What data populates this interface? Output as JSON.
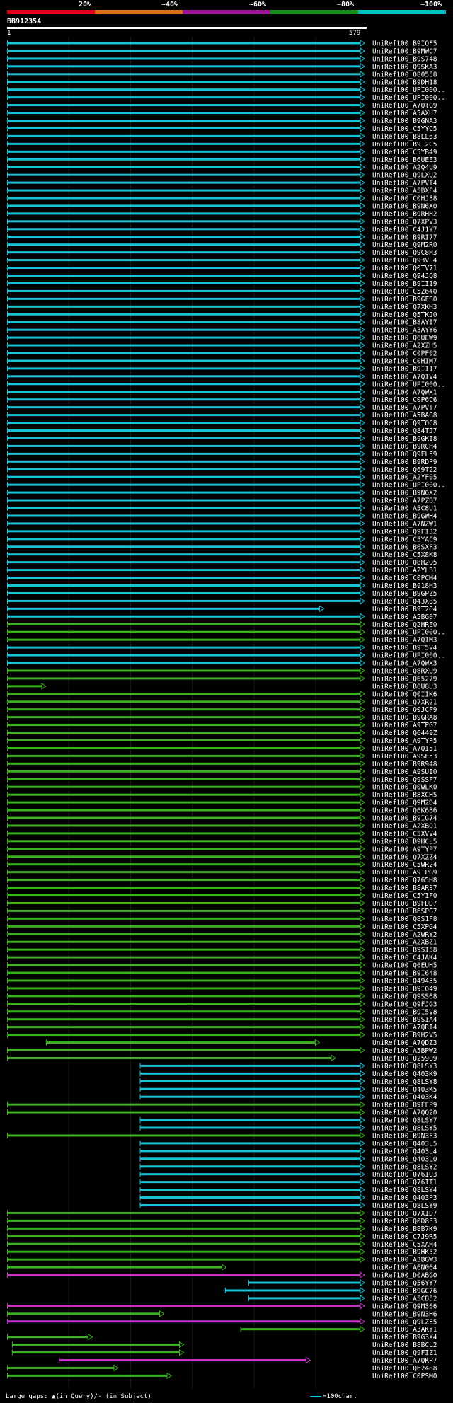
{
  "legend": {
    "labels": [
      "20%",
      "~40%",
      "~60%",
      "~80%",
      "~100%"
    ],
    "colors": [
      "#e0001a",
      "#e07010",
      "#a0109a",
      "#109010",
      "#00c0c8"
    ]
  },
  "query": {
    "id": "BB912354",
    "start": "1",
    "end": "579"
  },
  "hits": [
    {
      "id": "UniRef100_B9IQF5",
      "s": 0,
      "e": 579,
      "c": "cyan"
    },
    {
      "id": "UniRef100_B9MWC7",
      "s": 0,
      "e": 579,
      "c": "cyan"
    },
    {
      "id": "UniRef100_B9S748",
      "s": 0,
      "e": 579,
      "c": "cyan"
    },
    {
      "id": "UniRef100_Q9SKA3",
      "s": 0,
      "e": 579,
      "c": "cyan"
    },
    {
      "id": "UniRef100_O80558",
      "s": 0,
      "e": 579,
      "c": "cyan"
    },
    {
      "id": "UniRef100_B9DH18",
      "s": 0,
      "e": 579,
      "c": "cyan"
    },
    {
      "id": "UniRef100_UPI000..",
      "s": 0,
      "e": 579,
      "c": "cyan"
    },
    {
      "id": "UniRef100_UPI000..",
      "s": 0,
      "e": 579,
      "c": "cyan"
    },
    {
      "id": "UniRef100_A7QTG9",
      "s": 0,
      "e": 579,
      "c": "cyan"
    },
    {
      "id": "UniRef100_A5AXU7",
      "s": 0,
      "e": 579,
      "c": "cyan"
    },
    {
      "id": "UniRef100_B9GNA3",
      "s": 0,
      "e": 579,
      "c": "cyan"
    },
    {
      "id": "UniRef100_C5YYC5",
      "s": 0,
      "e": 579,
      "c": "cyan"
    },
    {
      "id": "UniRef100_B8LL63",
      "s": 0,
      "e": 579,
      "c": "cyan"
    },
    {
      "id": "UniRef100_B9T2C5",
      "s": 0,
      "e": 579,
      "c": "cyan"
    },
    {
      "id": "UniRef100_C5YB49",
      "s": 0,
      "e": 579,
      "c": "cyan"
    },
    {
      "id": "UniRef100_B6UEE3",
      "s": 0,
      "e": 579,
      "c": "cyan"
    },
    {
      "id": "UniRef100_A2Q4U9",
      "s": 0,
      "e": 579,
      "c": "cyan"
    },
    {
      "id": "UniRef100_Q9LXU2",
      "s": 0,
      "e": 579,
      "c": "cyan"
    },
    {
      "id": "UniRef100_A7PVT4",
      "s": 0,
      "e": 579,
      "c": "cyan"
    },
    {
      "id": "UniRef100_A5BXF4",
      "s": 0,
      "e": 579,
      "c": "cyan"
    },
    {
      "id": "UniRef100_C0HJ38",
      "s": 0,
      "e": 579,
      "c": "cyan"
    },
    {
      "id": "UniRef100_B9N6X0",
      "s": 0,
      "e": 579,
      "c": "cyan"
    },
    {
      "id": "UniRef100_B9RHH2",
      "s": 0,
      "e": 579,
      "c": "cyan"
    },
    {
      "id": "UniRef100_Q7XPV3",
      "s": 0,
      "e": 579,
      "c": "cyan"
    },
    {
      "id": "UniRef100_C4J1Y7",
      "s": 0,
      "e": 579,
      "c": "cyan"
    },
    {
      "id": "UniRef100_B9RI77",
      "s": 0,
      "e": 579,
      "c": "cyan"
    },
    {
      "id": "UniRef100_Q9M2R0",
      "s": 0,
      "e": 579,
      "c": "cyan"
    },
    {
      "id": "UniRef100_Q9C8H3",
      "s": 0,
      "e": 579,
      "c": "cyan"
    },
    {
      "id": "UniRef100_Q93VL4",
      "s": 0,
      "e": 579,
      "c": "cyan"
    },
    {
      "id": "UniRef100_Q0TV71",
      "s": 0,
      "e": 579,
      "c": "cyan"
    },
    {
      "id": "UniRef100_Q94JQ8",
      "s": 0,
      "e": 579,
      "c": "cyan"
    },
    {
      "id": "UniRef100_B9II19",
      "s": 0,
      "e": 579,
      "c": "cyan"
    },
    {
      "id": "UniRef100_C5Z640",
      "s": 0,
      "e": 579,
      "c": "cyan"
    },
    {
      "id": "UniRef100_B9GFS0",
      "s": 0,
      "e": 579,
      "c": "cyan"
    },
    {
      "id": "UniRef100_Q7XKH3",
      "s": 0,
      "e": 579,
      "c": "cyan"
    },
    {
      "id": "UniRef100_Q5TKJ0",
      "s": 0,
      "e": 579,
      "c": "cyan"
    },
    {
      "id": "UniRef100_B8AYI7",
      "s": 0,
      "e": 579,
      "c": "cyan"
    },
    {
      "id": "UniRef100_A3AYY6",
      "s": 0,
      "e": 579,
      "c": "cyan"
    },
    {
      "id": "UniRef100_Q6UEW9",
      "s": 0,
      "e": 579,
      "c": "cyan"
    },
    {
      "id": "UniRef100_A2XZH5",
      "s": 0,
      "e": 579,
      "c": "cyan"
    },
    {
      "id": "UniRef100_C0PF02",
      "s": 0,
      "e": 579,
      "c": "cyan"
    },
    {
      "id": "UniRef100_C0HIM7",
      "s": 0,
      "e": 579,
      "c": "cyan"
    },
    {
      "id": "UniRef100_B9II17",
      "s": 0,
      "e": 579,
      "c": "cyan"
    },
    {
      "id": "UniRef100_A7QIV4",
      "s": 0,
      "e": 579,
      "c": "cyan"
    },
    {
      "id": "UniRef100_UPI000..",
      "s": 0,
      "e": 579,
      "c": "cyan"
    },
    {
      "id": "UniRef100_A7QWX1",
      "s": 0,
      "e": 579,
      "c": "cyan"
    },
    {
      "id": "UniRef100_C0P6C6",
      "s": 0,
      "e": 579,
      "c": "cyan"
    },
    {
      "id": "UniRef100_A7PVT7",
      "s": 0,
      "e": 579,
      "c": "cyan"
    },
    {
      "id": "UniRef100_A5BAG8",
      "s": 0,
      "e": 579,
      "c": "cyan"
    },
    {
      "id": "UniRef100_Q9TOC8",
      "s": 0,
      "e": 579,
      "c": "cyan"
    },
    {
      "id": "UniRef100_Q84TJ7",
      "s": 0,
      "e": 579,
      "c": "cyan"
    },
    {
      "id": "UniRef100_B9GKI8",
      "s": 0,
      "e": 579,
      "c": "cyan"
    },
    {
      "id": "UniRef100_B9RCH4",
      "s": 0,
      "e": 579,
      "c": "cyan"
    },
    {
      "id": "UniRef100_Q9FL59",
      "s": 0,
      "e": 579,
      "c": "cyan"
    },
    {
      "id": "UniRef100_B9RDP9",
      "s": 0,
      "e": 579,
      "c": "cyan"
    },
    {
      "id": "UniRef100_Q69T22",
      "s": 0,
      "e": 579,
      "c": "cyan"
    },
    {
      "id": "UniRef100_A2YF05",
      "s": 0,
      "e": 579,
      "c": "cyan"
    },
    {
      "id": "UniRef100_UPI000..",
      "s": 0,
      "e": 579,
      "c": "cyan"
    },
    {
      "id": "UniRef100_B9N6X2",
      "s": 0,
      "e": 579,
      "c": "cyan"
    },
    {
      "id": "UniRef100_A7PZB7",
      "s": 0,
      "e": 579,
      "c": "cyan"
    },
    {
      "id": "UniRef100_A5C8U1",
      "s": 0,
      "e": 579,
      "c": "cyan"
    },
    {
      "id": "UniRef100_B9GWH4",
      "s": 0,
      "e": 579,
      "c": "cyan"
    },
    {
      "id": "UniRef100_A7NZW1",
      "s": 0,
      "e": 579,
      "c": "cyan"
    },
    {
      "id": "UniRef100_Q9FI32",
      "s": 0,
      "e": 579,
      "c": "cyan"
    },
    {
      "id": "UniRef100_C5YAC9",
      "s": 0,
      "e": 579,
      "c": "cyan"
    },
    {
      "id": "UniRef100_B6SXF3",
      "s": 0,
      "e": 579,
      "c": "cyan"
    },
    {
      "id": "UniRef100_C5X8K8",
      "s": 0,
      "e": 579,
      "c": "cyan"
    },
    {
      "id": "UniRef100_Q8H2Q5",
      "s": 0,
      "e": 579,
      "c": "cyan"
    },
    {
      "id": "UniRef100_A2YLB1",
      "s": 0,
      "e": 579,
      "c": "cyan"
    },
    {
      "id": "UniRef100_C0PCM4",
      "s": 0,
      "e": 579,
      "c": "cyan"
    },
    {
      "id": "UniRef100_B918H3",
      "s": 0,
      "e": 579,
      "c": "cyan"
    },
    {
      "id": "UniRef100_B9GPZ5",
      "s": 0,
      "e": 579,
      "c": "cyan"
    },
    {
      "id": "UniRef100_Q43X85",
      "s": 0,
      "e": 579,
      "c": "cyan"
    },
    {
      "id": "UniRef100_B9T264",
      "s": 0,
      "e": 513,
      "c": "cyan"
    },
    {
      "id": "UniRef100_A5BG07",
      "s": 0,
      "e": 579,
      "c": "cyan"
    },
    {
      "id": "UniRef100_Q2HRE0",
      "s": 0,
      "e": 579,
      "c": "green"
    },
    {
      "id": "UniRef100_UPI000..",
      "s": 0,
      "e": 579,
      "c": "green"
    },
    {
      "id": "UniRef100_A7QIM3",
      "s": 0,
      "e": 579,
      "c": "green"
    },
    {
      "id": "UniRef100_B9T5V4",
      "s": 0,
      "e": 579,
      "c": "cyan"
    },
    {
      "id": "UniRef100_UPI000..",
      "s": 0,
      "e": 579,
      "c": "cyan"
    },
    {
      "id": "UniRef100_A7QWX3",
      "s": 0,
      "e": 579,
      "c": "cyan"
    },
    {
      "id": "UniRef100_Q8RXU9",
      "s": 0,
      "e": 579,
      "c": "green"
    },
    {
      "id": "UniRef100_Q65279",
      "s": 0,
      "e": 579,
      "c": "green"
    },
    {
      "id": "UniRef100_B6U8U3",
      "s": 0,
      "e": 63,
      "c": "green"
    },
    {
      "id": "UniRef100_Q0IIK6",
      "s": 0,
      "e": 579,
      "c": "green"
    },
    {
      "id": "UniRef100_Q7XR21",
      "s": 0,
      "e": 579,
      "c": "green"
    },
    {
      "id": "UniRef100_Q0JCF9",
      "s": 0,
      "e": 579,
      "c": "green"
    },
    {
      "id": "UniRef100_B9GRA8",
      "s": 0,
      "e": 579,
      "c": "green"
    },
    {
      "id": "UniRef100_A9TPG7",
      "s": 0,
      "e": 579,
      "c": "green"
    },
    {
      "id": "UniRef100_Q6449Z",
      "s": 0,
      "e": 579,
      "c": "green"
    },
    {
      "id": "UniRef100_A9TYP5",
      "s": 0,
      "e": 579,
      "c": "green"
    },
    {
      "id": "UniRef100_A7QI51",
      "s": 0,
      "e": 579,
      "c": "green"
    },
    {
      "id": "UniRef100_A9SE53",
      "s": 0,
      "e": 579,
      "c": "green"
    },
    {
      "id": "UniRef100_B9R948",
      "s": 0,
      "e": 579,
      "c": "green"
    },
    {
      "id": "UniRef100_A9SUI0",
      "s": 0,
      "e": 579,
      "c": "green"
    },
    {
      "id": "UniRef100_Q9SSF7",
      "s": 0,
      "e": 579,
      "c": "green"
    },
    {
      "id": "UniRef100_Q0WLK0",
      "s": 0,
      "e": 579,
      "c": "green"
    },
    {
      "id": "UniRef100_B8XCH5",
      "s": 0,
      "e": 579,
      "c": "green"
    },
    {
      "id": "UniRef100_Q9M2D4",
      "s": 0,
      "e": 579,
      "c": "green"
    },
    {
      "id": "UniRef100_Q6K6B6",
      "s": 0,
      "e": 579,
      "c": "green"
    },
    {
      "id": "UniRef100_B9IG74",
      "s": 0,
      "e": 579,
      "c": "green"
    },
    {
      "id": "UniRef100_A2XBQ1",
      "s": 0,
      "e": 579,
      "c": "green"
    },
    {
      "id": "UniRef100_C5XVV4",
      "s": 0,
      "e": 579,
      "c": "green"
    },
    {
      "id": "UniRef100_B9HCL5",
      "s": 0,
      "e": 579,
      "c": "green"
    },
    {
      "id": "UniRef100_A9TYP7",
      "s": 0,
      "e": 579,
      "c": "green"
    },
    {
      "id": "UniRef100_Q7XZZ4",
      "s": 0,
      "e": 579,
      "c": "green"
    },
    {
      "id": "UniRef100_C5WR24",
      "s": 0,
      "e": 579,
      "c": "green"
    },
    {
      "id": "UniRef100_A9TPG9",
      "s": 0,
      "e": 579,
      "c": "green"
    },
    {
      "id": "UniRef100_Q765H8",
      "s": 0,
      "e": 579,
      "c": "green"
    },
    {
      "id": "UniRef100_B8ARS7",
      "s": 0,
      "e": 579,
      "c": "green"
    },
    {
      "id": "UniRef100_C5YIF0",
      "s": 0,
      "e": 579,
      "c": "green"
    },
    {
      "id": "UniRef100_B9FDD7",
      "s": 0,
      "e": 579,
      "c": "green"
    },
    {
      "id": "UniRef100_B6SPG7",
      "s": 0,
      "e": 579,
      "c": "green"
    },
    {
      "id": "UniRef100_Q8S1F8",
      "s": 0,
      "e": 579,
      "c": "green"
    },
    {
      "id": "UniRef100_C5XPG4",
      "s": 0,
      "e": 579,
      "c": "green"
    },
    {
      "id": "UniRef100_A2WRY2",
      "s": 0,
      "e": 579,
      "c": "green"
    },
    {
      "id": "UniRef100_A2XBZ1",
      "s": 0,
      "e": 579,
      "c": "green"
    },
    {
      "id": "UniRef100_B9SI58",
      "s": 0,
      "e": 579,
      "c": "green"
    },
    {
      "id": "UniRef100_C4JAK4",
      "s": 0,
      "e": 579,
      "c": "green"
    },
    {
      "id": "UniRef100_Q6EUH5",
      "s": 0,
      "e": 579,
      "c": "green"
    },
    {
      "id": "UniRef100_B9I648",
      "s": 0,
      "e": 579,
      "c": "green"
    },
    {
      "id": "UniRef100_Q49435",
      "s": 0,
      "e": 579,
      "c": "green"
    },
    {
      "id": "UniRef100_B9I649",
      "s": 0,
      "e": 579,
      "c": "green"
    },
    {
      "id": "UniRef100_Q9SS68",
      "s": 0,
      "e": 579,
      "c": "green"
    },
    {
      "id": "UniRef100_Q9FJG3",
      "s": 0,
      "e": 579,
      "c": "green"
    },
    {
      "id": "UniRef100_B9I5V8",
      "s": 0,
      "e": 579,
      "c": "green"
    },
    {
      "id": "UniRef100_B9SIA4",
      "s": 0,
      "e": 579,
      "c": "green"
    },
    {
      "id": "UniRef100_A7QRI4",
      "s": 0,
      "e": 579,
      "c": "green"
    },
    {
      "id": "UniRef100_B9H2V5",
      "s": 0,
      "e": 579,
      "c": "green"
    },
    {
      "id": "UniRef100_A7QDZ3",
      "s": 63,
      "e": 506,
      "c": "green"
    },
    {
      "id": "UniRef100_A5BPW2",
      "s": 0,
      "e": 579,
      "c": "green"
    },
    {
      "id": "UniRef100_Q259Q9",
      "s": 0,
      "e": 532,
      "c": "green"
    },
    {
      "id": "UniRef100_Q8LSY3",
      "s": 215,
      "e": 579,
      "c": "cyan"
    },
    {
      "id": "UniRef100_Q403K9",
      "s": 215,
      "e": 579,
      "c": "cyan"
    },
    {
      "id": "UniRef100_Q8LSY8",
      "s": 215,
      "e": 579,
      "c": "cyan"
    },
    {
      "id": "UniRef100_Q403K5",
      "s": 215,
      "e": 579,
      "c": "cyan"
    },
    {
      "id": "UniRef100_Q403K4",
      "s": 215,
      "e": 579,
      "c": "cyan"
    },
    {
      "id": "UniRef100_B9FFP9",
      "s": 0,
      "e": 579,
      "c": "green"
    },
    {
      "id": "UniRef100_A7QQ20",
      "s": 0,
      "e": 579,
      "c": "green"
    },
    {
      "id": "UniRef100_Q8LSY7",
      "s": 215,
      "e": 579,
      "c": "cyan"
    },
    {
      "id": "UniRef100_Q8LSY5",
      "s": 215,
      "e": 579,
      "c": "cyan"
    },
    {
      "id": "UniRef100_B9N3F3",
      "s": 0,
      "e": 579,
      "c": "green"
    },
    {
      "id": "UniRef100_Q403L5",
      "s": 215,
      "e": 579,
      "c": "cyan"
    },
    {
      "id": "UniRef100_Q403L4",
      "s": 215,
      "e": 579,
      "c": "cyan"
    },
    {
      "id": "UniRef100_Q403L0",
      "s": 215,
      "e": 579,
      "c": "cyan"
    },
    {
      "id": "UniRef100_Q8LSY2",
      "s": 215,
      "e": 579,
      "c": "cyan"
    },
    {
      "id": "UniRef100_Q76IU3",
      "s": 215,
      "e": 579,
      "c": "cyan"
    },
    {
      "id": "UniRef100_Q76IT1",
      "s": 215,
      "e": 579,
      "c": "cyan"
    },
    {
      "id": "UniRef100_Q8LSY4",
      "s": 215,
      "e": 579,
      "c": "cyan"
    },
    {
      "id": "UniRef100_Q403P3",
      "s": 215,
      "e": 579,
      "c": "cyan"
    },
    {
      "id": "UniRef100_Q8LSY9",
      "s": 215,
      "e": 579,
      "c": "cyan"
    },
    {
      "id": "UniRef100_Q7XID7",
      "s": 0,
      "e": 579,
      "c": "green"
    },
    {
      "id": "UniRef100_Q0D8E3",
      "s": 0,
      "e": 579,
      "c": "green"
    },
    {
      "id": "UniRef100_B8B7K9",
      "s": 0,
      "e": 579,
      "c": "green"
    },
    {
      "id": "UniRef100_C7J9R5",
      "s": 0,
      "e": 579,
      "c": "green"
    },
    {
      "id": "UniRef100_C5XAH4",
      "s": 0,
      "e": 579,
      "c": "green"
    },
    {
      "id": "UniRef100_B9HK52",
      "s": 0,
      "e": 579,
      "c": "green"
    },
    {
      "id": "UniRef100_A3BGW3",
      "s": 0,
      "e": 579,
      "c": "green"
    },
    {
      "id": "UniRef100_A6N064",
      "s": 0,
      "e": 355,
      "c": "green"
    },
    {
      "id": "UniRef100_D0ABG0",
      "s": 0,
      "e": 579,
      "c": "magenta"
    },
    {
      "id": "UniRef100_Q56YY7",
      "s": 391,
      "e": 579,
      "c": "cyan"
    },
    {
      "id": "UniRef100_B9GC76",
      "s": 353,
      "e": 579,
      "c": "cyan"
    },
    {
      "id": "UniRef100_A5CB52",
      "s": 391,
      "e": 579,
      "c": "cyan"
    },
    {
      "id": "UniRef100_Q9M366",
      "s": 0,
      "e": 579,
      "c": "magenta"
    },
    {
      "id": "UniRef100_B9N3H6",
      "s": 0,
      "e": 254,
      "c": "green"
    },
    {
      "id": "UniRef100_Q9LZE5",
      "s": 0,
      "e": 579,
      "c": "magenta"
    },
    {
      "id": "UniRef100_A3AKY1",
      "s": 378,
      "e": 579,
      "c": "green"
    },
    {
      "id": "UniRef100_B9G3X4",
      "s": 0,
      "e": 138,
      "c": "green"
    },
    {
      "id": "UniRef100_B8BCL2",
      "s": 8,
      "e": 286,
      "c": "green"
    },
    {
      "id": "UniRef100_Q9FIZ1",
      "s": 8,
      "e": 286,
      "c": "green"
    },
    {
      "id": "UniRef100_A7QKP7",
      "s": 84,
      "e": 491,
      "c": "magenta"
    },
    {
      "id": "UniRef100_Q62488",
      "s": 0,
      "e": 180,
      "c": "green"
    },
    {
      "id": "UniRef100_C0PSM0",
      "s": 0,
      "e": 266,
      "c": "green"
    }
  ],
  "footer": {
    "left": "Large gaps: ▲(in Query)/- (in Subject)",
    "right": "=100char."
  }
}
